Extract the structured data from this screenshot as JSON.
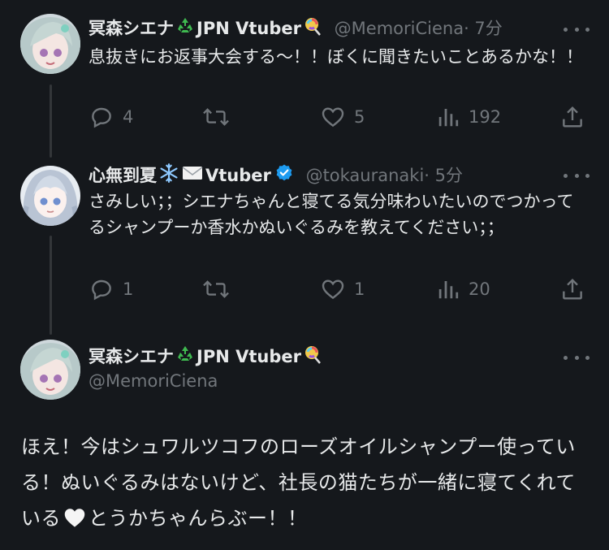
{
  "tweets": [
    {
      "name": "冥森シエナ",
      "name_suffix": "JPN Vtuber",
      "handle": "@MemoriCiena",
      "time": "· 7分",
      "text": "息抜きにお返事大会する〜！！ぼくに聞きたいことあるかな！！",
      "replies": "4",
      "retweets": "",
      "likes": "5",
      "views": "192"
    },
    {
      "name": "心無到夏",
      "name_suffix": "Vtuber",
      "handle": "@tokauranaki",
      "time": "· 5分",
      "text": "さみしい；；シエナちゃんと寝てる気分味わいたいのでつかってるシャンプーか香水かぬいぐるみを教えてください；；",
      "replies": "1",
      "retweets": "",
      "likes": "1",
      "views": "20"
    }
  ],
  "main_tweet": {
    "name": "冥森シエナ",
    "name_suffix": "JPN Vtuber",
    "handle": "@MemoriCiena",
    "text_part1": "ほえ！今はシュワルツコフのローズオイルシャンプー使っている！ぬいぐるみはないけど、社長の猫たちが一緒に寝てくれている",
    "text_part2": "とうかちゃんらぶー！！"
  },
  "colors": {
    "background": "#15181c",
    "text": "#e7e9ea",
    "muted": "#71767b",
    "verified": "#1d9bf0",
    "thread_line": "#333639"
  },
  "icons": [
    "recycle-icon",
    "lollipop-icon",
    "snowflake-icon",
    "envelope-icon",
    "verified-badge-icon",
    "reply-icon",
    "retweet-icon",
    "like-icon",
    "views-icon",
    "share-icon",
    "more-icon",
    "white-heart-icon"
  ]
}
